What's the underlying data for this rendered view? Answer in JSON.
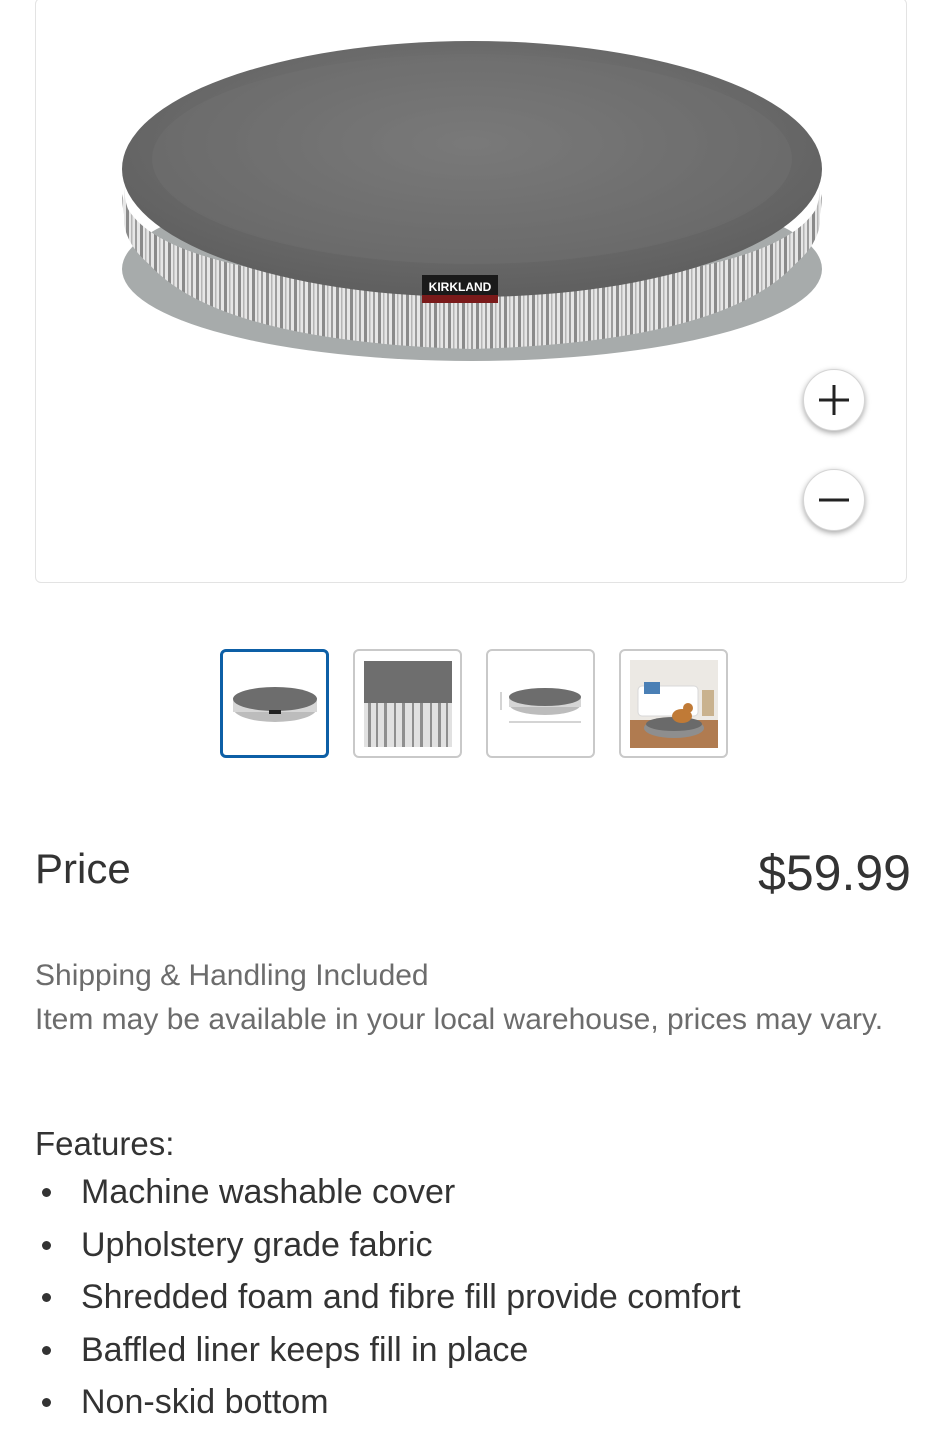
{
  "product": {
    "brand_tag": "KIRKLAND",
    "zoom_in_icon": "plus-icon",
    "zoom_out_icon": "minus-icon"
  },
  "thumbnails": [
    {
      "name": "bed-front-view",
      "selected": true
    },
    {
      "name": "fabric-closeup",
      "selected": false
    },
    {
      "name": "bed-dimensions",
      "selected": false
    },
    {
      "name": "bed-with-dog-lifestyle",
      "selected": false
    }
  ],
  "price": {
    "label": "Price",
    "value": "$59.99"
  },
  "shipping": {
    "line1": "Shipping & Handling Included",
    "line2": "Item may be available in your local warehouse, prices may vary."
  },
  "features": {
    "title": "Features:",
    "items": [
      "Machine washable cover",
      "Upholstery grade fabric",
      "Shredded foam and fibre fill provide comfort",
      "Baffled liner keeps fill in place",
      "Non-skid bottom"
    ]
  },
  "colors": {
    "selected_border": "#0d5fa6",
    "text_primary": "#333333",
    "text_secondary": "#6c6c6c"
  }
}
